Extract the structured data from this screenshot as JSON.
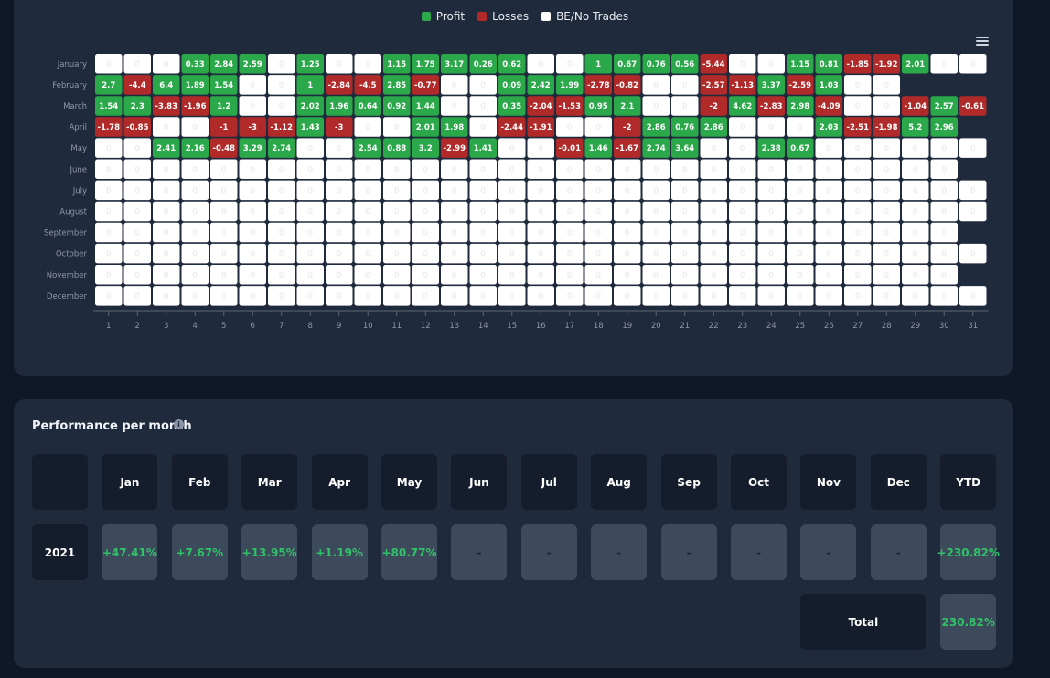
{
  "legend": {
    "profit": {
      "label": "Profit",
      "color": "#2aa84a"
    },
    "losses": {
      "label": "Losses",
      "color": "#b02a2a"
    },
    "be": {
      "label": "BE/No Trades",
      "color": "#ffffff"
    }
  },
  "menu_icon": "hamburger-menu-icon",
  "chart_data": {
    "type": "heatmap",
    "title": "",
    "x": [
      1,
      2,
      3,
      4,
      5,
      6,
      7,
      8,
      9,
      10,
      11,
      12,
      13,
      14,
      15,
      16,
      17,
      18,
      19,
      20,
      21,
      22,
      23,
      24,
      25,
      26,
      27,
      28,
      29,
      30,
      31
    ],
    "y": [
      "January",
      "February",
      "March",
      "April",
      "May",
      "June",
      "July",
      "August",
      "September",
      "October",
      "November",
      "December"
    ],
    "days_in_month": [
      31,
      28,
      31,
      30,
      31,
      30,
      31,
      31,
      30,
      31,
      30,
      31
    ],
    "values": [
      [
        0,
        0,
        0,
        0.33,
        2.84,
        2.59,
        0,
        1.25,
        0,
        0,
        1.15,
        1.75,
        3.17,
        0.26,
        0.62,
        0,
        0,
        1,
        0.67,
        0.76,
        0.56,
        -5.44,
        0,
        0,
        1.15,
        0.81,
        -1.85,
        -1.92,
        2.01,
        0,
        0
      ],
      [
        2.7,
        -4.4,
        6.4,
        1.89,
        1.54,
        0,
        0,
        1,
        -2.84,
        -4.5,
        2.85,
        -0.77,
        0,
        0,
        0.09,
        2.42,
        1.99,
        -2.78,
        -0.82,
        0,
        0,
        -2.57,
        -1.13,
        3.37,
        -2.59,
        1.03,
        0,
        0
      ],
      [
        1.54,
        2.3,
        -3.83,
        -1.96,
        1.2,
        0,
        0,
        2.02,
        1.96,
        0.64,
        0.92,
        1.44,
        0,
        0,
        0.35,
        -2.04,
        -1.53,
        0.95,
        2.1,
        0,
        0,
        -2,
        4.62,
        -2.83,
        2.98,
        -4.09,
        0,
        0,
        -1.04,
        2.57,
        -0.61
      ],
      [
        -1.78,
        -0.85,
        0,
        0,
        -1,
        -3,
        -1.12,
        1.43,
        -3,
        0,
        0,
        2.01,
        1.98,
        0,
        -2.44,
        -1.91,
        0,
        0,
        -2,
        2.86,
        0.76,
        2.86,
        0,
        0,
        0,
        2.03,
        -2.51,
        -1.98,
        5.2,
        2.96
      ],
      [
        0,
        0,
        2.41,
        2.16,
        -0.48,
        3.29,
        2.74,
        0,
        0,
        2.54,
        0.88,
        3.2,
        -2.99,
        1.41,
        0,
        0,
        -0.01,
        1.46,
        -1.67,
        2.74,
        3.64,
        0,
        0,
        2.38,
        0.67,
        0,
        0,
        0,
        0,
        0,
        0
      ],
      [
        0,
        0,
        0,
        0,
        0,
        0,
        0,
        0,
        0,
        0,
        0,
        0,
        0,
        0,
        0,
        0,
        0,
        0,
        0,
        0,
        0,
        0,
        0,
        0,
        0,
        0,
        0,
        0,
        0,
        0
      ],
      [
        0,
        0,
        0,
        0,
        0,
        0,
        0,
        0,
        0,
        0,
        0,
        0,
        0,
        0,
        0,
        0,
        0,
        0,
        0,
        0,
        0,
        0,
        0,
        0,
        0,
        0,
        0,
        0,
        0,
        0,
        0
      ],
      [
        0,
        0,
        0,
        0,
        0,
        0,
        0,
        0,
        0,
        0,
        0,
        0,
        0,
        0,
        0,
        0,
        0,
        0,
        0,
        0,
        0,
        0,
        0,
        0,
        0,
        0,
        0,
        0,
        0,
        0,
        0
      ],
      [
        0,
        0,
        0,
        0,
        0,
        0,
        0,
        0,
        0,
        0,
        0,
        0,
        0,
        0,
        0,
        0,
        0,
        0,
        0,
        0,
        0,
        0,
        0,
        0,
        0,
        0,
        0,
        0,
        0,
        0
      ],
      [
        0,
        0,
        0,
        0,
        0,
        0,
        0,
        0,
        0,
        0,
        0,
        0,
        0,
        0,
        0,
        0,
        0,
        0,
        0,
        0,
        0,
        0,
        0,
        0,
        0,
        0,
        0,
        0,
        0,
        0,
        0
      ],
      [
        0,
        0,
        0,
        0,
        0,
        0,
        0,
        0,
        0,
        0,
        0,
        0,
        0,
        0,
        0,
        0,
        0,
        0,
        0,
        0,
        0,
        0,
        0,
        0,
        0,
        0,
        0,
        0,
        0,
        0
      ],
      [
        0,
        0,
        0,
        0,
        0,
        0,
        0,
        0,
        0,
        0,
        0,
        0,
        0,
        0,
        0,
        0,
        0,
        0,
        0,
        0,
        0,
        0,
        0,
        0,
        0,
        0,
        0,
        0,
        0,
        0,
        0
      ]
    ],
    "color_scale": {
      "positive": "#2aa84a",
      "negative": "#b02a2a",
      "zero": "#ffffff"
    }
  },
  "performance": {
    "title": "Performance per month",
    "info_icon": "info-icon",
    "months": [
      "Jan",
      "Feb",
      "Mar",
      "Apr",
      "May",
      "Jun",
      "Jul",
      "Aug",
      "Sep",
      "Oct",
      "Nov",
      "Dec",
      "YTD"
    ],
    "year": "2021",
    "values": [
      "+47.41%",
      "+7.67%",
      "+13.95%",
      "+1.19%",
      "+80.77%",
      "-",
      "-",
      "-",
      "-",
      "-",
      "-",
      "-",
      "+230.82%"
    ],
    "total_label": "Total",
    "total_value": "230.82%",
    "positive_color": "#2fc266"
  }
}
